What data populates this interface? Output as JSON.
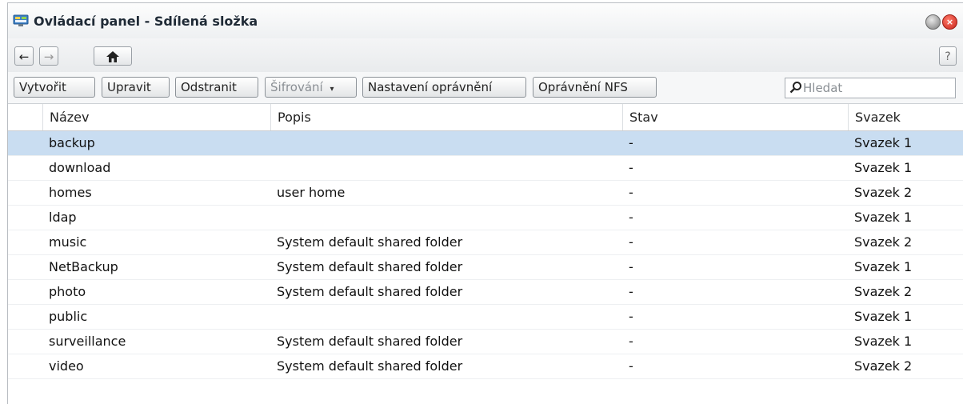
{
  "window": {
    "title": "Ovládací panel - Sdílená složka"
  },
  "nav": {
    "back": "←",
    "forward": "→",
    "home": "⌂",
    "help": "?"
  },
  "toolbar": {
    "create": "Vytvořit",
    "edit": "Upravit",
    "delete": "Odstranit",
    "encryption": "Šifrování",
    "permissions": "Nastavení oprávnění",
    "nfs": "Oprávnění NFS",
    "search_placeholder": "Hledat"
  },
  "table": {
    "columns": [
      "Název",
      "Popis",
      "Stav",
      "Svazek"
    ],
    "rows": [
      {
        "name": "backup",
        "desc": "",
        "status": "-",
        "volume": "Svazek 1",
        "selected": true
      },
      {
        "name": "download",
        "desc": "",
        "status": "-",
        "volume": "Svazek 1"
      },
      {
        "name": "homes",
        "desc": "user home",
        "status": "-",
        "volume": "Svazek 2"
      },
      {
        "name": "ldap",
        "desc": "",
        "status": "-",
        "volume": "Svazek 1"
      },
      {
        "name": "music",
        "desc": "System default shared folder",
        "status": "-",
        "volume": "Svazek 2"
      },
      {
        "name": "NetBackup",
        "desc": "System default shared folder",
        "status": "-",
        "volume": "Svazek 1"
      },
      {
        "name": "photo",
        "desc": "System default shared folder",
        "status": "-",
        "volume": "Svazek 2"
      },
      {
        "name": "public",
        "desc": "",
        "status": "-",
        "volume": "Svazek 1"
      },
      {
        "name": "surveillance",
        "desc": "System default shared folder",
        "status": "-",
        "volume": "Svazek 1"
      },
      {
        "name": "video",
        "desc": "System default shared folder",
        "status": "-",
        "volume": "Svazek 2"
      }
    ]
  },
  "colors": {
    "selected_row": "#c9ddf1",
    "close_button": "#d4281c"
  }
}
